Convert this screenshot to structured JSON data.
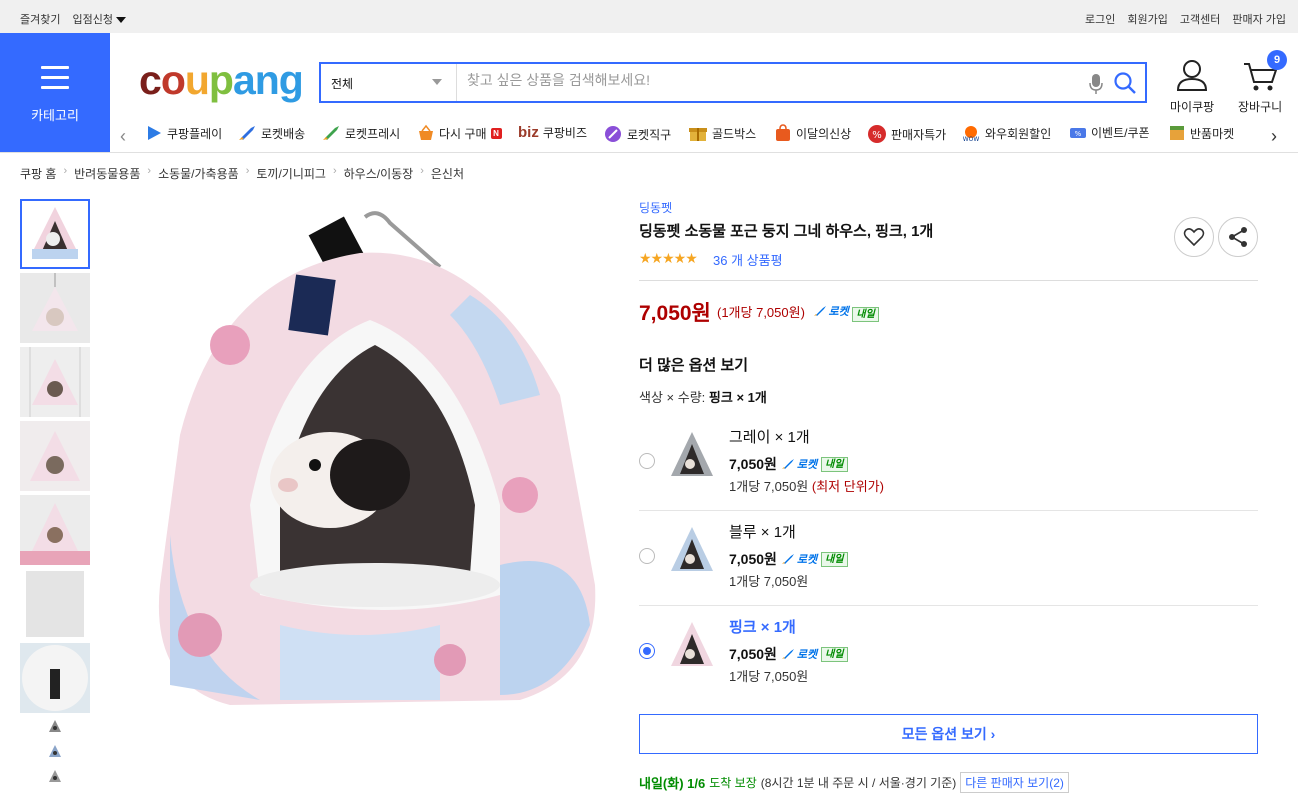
{
  "topbar": {
    "left": [
      "즐겨찾기",
      "입점신청"
    ],
    "right": [
      "로그인",
      "회원가입",
      "고객센터",
      "판매자 가입"
    ]
  },
  "header": {
    "category_label": "카테고리",
    "logo_text": [
      "c",
      "o",
      "u",
      "p",
      "ang"
    ],
    "search_scope": "전체",
    "search_placeholder": "찾고 싶은 상품을 검색해보세요!",
    "mypage_label": "마이쿠팡",
    "cart_label": "장바구니",
    "cart_count": "9"
  },
  "subnav": [
    {
      "label": "쿠팡플레이",
      "color": "#2c7be5"
    },
    {
      "label": "로켓배송",
      "color": "#2f6fe0"
    },
    {
      "label": "로켓프레시",
      "color": "#3fa34d"
    },
    {
      "label": "다시 구매",
      "color": "#f08a24"
    },
    {
      "label": "쿠팡비즈",
      "prefix": "biz",
      "color": "#9b3b2a"
    },
    {
      "label": "로켓직구",
      "color": "#8a4fd8"
    },
    {
      "label": "골드박스",
      "color": "#e2b23a"
    },
    {
      "label": "이달의신상",
      "color": "#e85a1e"
    },
    {
      "label": "판매자특가",
      "color": "#d62b2b"
    },
    {
      "label": "와우회원할인",
      "color": "#ff6a00"
    },
    {
      "label": "이벤트/쿠폰",
      "color": "#4a78e8"
    },
    {
      "label": "반품마켓",
      "color": "#e7a23a"
    }
  ],
  "breadcrumb": [
    "쿠팡 홈",
    "반려동물용품",
    "소동물/가축용품",
    "토끼/기니피그",
    "하우스/이동장",
    "은신처"
  ],
  "product": {
    "brand": "딩동펫",
    "title": "딩동펫 소동물 포근 둥지 그네 하우스, 핑크, 1개",
    "stars": "★★★★★",
    "review_count": "36 개 상품평",
    "price": "7,050원",
    "unit_price": "(1개당 7,050원)",
    "rocket_label": "로켓",
    "tomorrow_label": "내일",
    "more_options_title": "더 많은 옵션 보기",
    "selection_label": "색상 × 수량:",
    "selection_value": "핑크 × 1개",
    "options": [
      {
        "name": "그레이 × 1개",
        "price": "7,050원",
        "unit": "1개당 7,050원",
        "note": "(최저 단위가)",
        "selected": false
      },
      {
        "name": "블루 × 1개",
        "price": "7,050원",
        "unit": "1개당 7,050원",
        "note": "",
        "selected": false
      },
      {
        "name": "핑크 × 1개",
        "price": "7,050원",
        "unit": "1개당 7,050원",
        "note": "",
        "selected": true
      }
    ],
    "all_options_button": "모든 옵션 보기",
    "delivery_day": "내일(화) 1/6",
    "delivery_guarantee": "도착 보장",
    "delivery_condition": "(8시간 1분 내 주문 시 / 서울·경기 기준)",
    "other_sellers": "다른 판매자 보기(2)"
  }
}
